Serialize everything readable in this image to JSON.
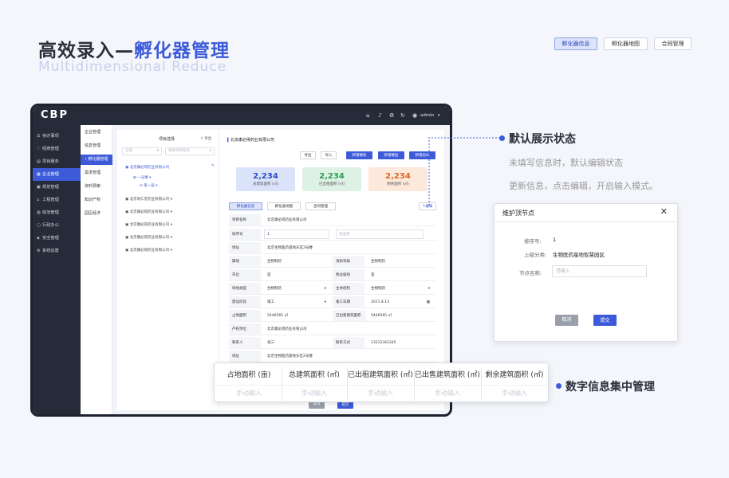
{
  "heading": {
    "prefix": "高效录入—",
    "highlight": "孵化器管理",
    "subtitle": "Multidimensional  Reduce"
  },
  "top_tabs": [
    {
      "label": "孵化器信息",
      "active": true
    },
    {
      "label": "孵化器地图",
      "active": false
    },
    {
      "label": "合同管理",
      "active": false
    }
  ],
  "app": {
    "logo": "CBP",
    "user": "admin",
    "sidebar": [
      "待办事项",
      "招商管理",
      "项目服务",
      "企业管理",
      "规划管理",
      "工程管理",
      "综治管理",
      "行政办公",
      "安全管理",
      "系统设置"
    ],
    "sidebar_active": 3,
    "subnav": [
      "企业管理",
      "信息管理",
      "孵化器管理",
      "需求管理",
      "资料预审",
      "知识产权",
      "园区经济"
    ],
    "subnav_active": 2,
    "left_panel": {
      "title": "项目选择",
      "export": "导出",
      "select_placeholder": "全部",
      "search_placeholder": "搜索项目名称",
      "selected_company": "北京康必得药业有限公司",
      "building": "一号楼",
      "floor": "第一层",
      "companies": [
        "北京同仁堂药业有限公司",
        "北京康必得药业有限公司",
        "北京康必得药业有限公司",
        "北京康必得药业有限公司",
        "北京康必得药业有限公司"
      ]
    },
    "right_panel": {
      "title": "北京康必得药业有限公司",
      "buttons": [
        "导出",
        "导入",
        "新增楼栋",
        "新增楼层",
        "新增房间"
      ],
      "stats": [
        {
          "value": "2,234",
          "label": "总建筑面积 (㎡)",
          "color": "#2f4bc9",
          "bg": "#dbe3fb"
        },
        {
          "value": "2,234",
          "label": "已出租面积 (㎡)",
          "color": "#2e9b51",
          "bg": "#ddf1e4"
        },
        {
          "value": "2,234",
          "label": "剩余面积 (㎡)",
          "color": "#d96a1e",
          "bg": "#fde8dc"
        }
      ],
      "tabs": [
        "孵化器信息",
        "孵化器地图",
        "合同管理"
      ],
      "edit": "编辑",
      "fields": {
        "project_name_label": "项目名称",
        "project_name": "北京康必得药业有限公司",
        "sort_label": "排序号",
        "sort": "1",
        "sort_placeholder": "请选择",
        "address_label": "地址",
        "address": "北京生物医药基地东区2号楼",
        "attr_label": "属地",
        "attr": "生物制药",
        "fire_label": "消防等级",
        "fire": "生物制药",
        "parking_label": "车位",
        "parking": "是",
        "property_level_label": "物业级别",
        "property_level": "是",
        "site_type_label": "场地类型",
        "site_type": "生物制药",
        "structure_label": "主体结构",
        "structure": "生物制药",
        "stage_label": "建设阶段",
        "stage": "竣工",
        "date_label": "竣工日期",
        "date": "2011.8.13",
        "land_label": "占地面积",
        "land": "5446565 ㎡",
        "sold_label": "已出售建筑面积",
        "sold": "5446565 ㎡",
        "owner_label": "产权单位",
        "owner": "北京康必得药业有限公司",
        "contact_label": "联系人",
        "contact": "张三",
        "phone_label": "联系方式",
        "phone": "13212342345",
        "address2_label": "地址",
        "address2": "北京生物医药基地东区2号楼"
      },
      "footer_cancel": "取消",
      "footer_submit": "提交"
    }
  },
  "float_table": {
    "headers": [
      "占地面积 (亩)",
      "总建筑面积 (㎡)",
      "已出租建筑面积 (㎡)",
      "已出售建筑面积 (㎡)",
      "剩余建筑面积 (㎡)"
    ],
    "placeholder": "手动输入"
  },
  "annotation1": {
    "title": "默认展示状态",
    "line1": "未填写信息时，默认编辑状态",
    "line2": "更新信息，点击编辑，开启输入模式。"
  },
  "annotation2": {
    "title": "数字信息集中管理"
  },
  "dialog": {
    "title": "维护顶节点",
    "close": "✕",
    "sort_label": "排序号:",
    "sort_value": "1",
    "parent_label": "上级分类:",
    "parent_value": "生物医药基地智慧园区",
    "node_label": "节点名称:",
    "node_placeholder": "请输入",
    "cancel": "取消",
    "submit": "提交"
  }
}
